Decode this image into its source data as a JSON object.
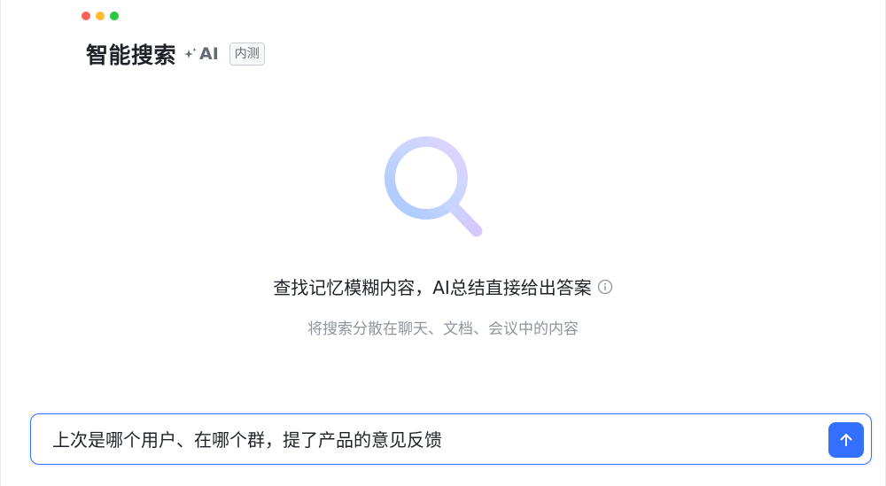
{
  "window": {
    "controls": [
      {
        "name": "close",
        "color": "#ff5f57"
      },
      {
        "name": "minimize",
        "color": "#febc2e"
      },
      {
        "name": "maximize",
        "color": "#28c840"
      }
    ]
  },
  "header": {
    "title": "智能搜索",
    "ai_label": "AI",
    "ai_icon": "sparkle-icon",
    "badge": "内测"
  },
  "hero": {
    "icon": "magnifier-icon",
    "headline": "查找记忆模糊内容，AI总结直接给出答案",
    "info_icon": "info-icon",
    "subline": "将搜索分散在聊天、文档、会议中的内容"
  },
  "composer": {
    "value": "上次是哪个用户、在哪个群，提了产品的意见反馈",
    "send_icon": "arrow-up-icon",
    "accent": "#3370ff"
  }
}
